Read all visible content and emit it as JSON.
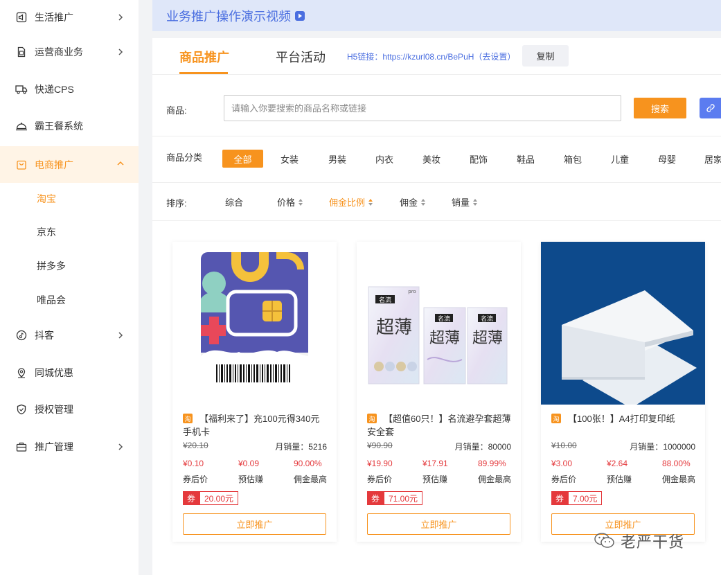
{
  "sidebar": {
    "items": [
      {
        "label": "生活推广",
        "icon": "megaphone-icon"
      },
      {
        "label": "运营商业务",
        "icon": "sim-card-icon"
      },
      {
        "label": "快递CPS",
        "icon": "truck-icon"
      },
      {
        "label": "霸王餐系统",
        "icon": "dish-cover-icon"
      },
      {
        "label": "电商推广",
        "icon": "shopping-bag-icon"
      },
      {
        "label": "抖客",
        "icon": "tiktok-icon"
      },
      {
        "label": "同城优惠",
        "icon": "location-pin-icon"
      },
      {
        "label": "授权管理",
        "icon": "shield-check-icon"
      },
      {
        "label": "推广管理",
        "icon": "briefcase-icon"
      }
    ],
    "sub_items": [
      "淘宝",
      "京东",
      "拼多多",
      "唯品会"
    ]
  },
  "banner": {
    "title": "业务推广操作演示视频"
  },
  "tabs": [
    "商品推广",
    "平台活动"
  ],
  "h5_link": "H5链接：https://kzurl08.cn/BePuH（去设置）",
  "copy_label": "复制",
  "search": {
    "label": "商品:",
    "placeholder": "请输入你要搜索的商品名称或链接",
    "button": "搜索"
  },
  "category": {
    "label": "商品分类",
    "items": [
      "全部",
      "女装",
      "男装",
      "内衣",
      "美妆",
      "配饰",
      "鞋品",
      "箱包",
      "儿童",
      "母婴",
      "居家"
    ]
  },
  "sort": {
    "label": "排序:",
    "items": [
      "综合",
      "价格",
      "佣金比例",
      "佣金",
      "销量"
    ]
  },
  "products": [
    {
      "platform_badge": "淘",
      "title": "【福利来了】充100元得340元手机卡",
      "original_price": "¥20.10",
      "monthly_sales": "月销量：5216",
      "coupon_price": "¥0.10",
      "estimated_earn": "¥0.09",
      "max_commission": "90.00%",
      "coupon_price_caption": "券后价",
      "estimated_earn_caption": "预估赚",
      "max_commission_caption": "佣金最高",
      "coupon_tag": "券",
      "coupon_amount": "20.00元",
      "promo_button": "立即推广"
    },
    {
      "platform_badge": "淘",
      "title": "【超值60只！】名流避孕套超薄安全套",
      "original_price": "¥90.90",
      "monthly_sales": "月销量：80000",
      "coupon_price": "¥19.90",
      "estimated_earn": "¥17.91",
      "max_commission": "89.99%",
      "coupon_price_caption": "券后价",
      "estimated_earn_caption": "预估赚",
      "max_commission_caption": "佣金最高",
      "coupon_tag": "券",
      "coupon_amount": "71.00元",
      "promo_button": "立即推广",
      "image_text": {
        "brand": "名流",
        "name": "超薄",
        "small": "pro"
      }
    },
    {
      "platform_badge": "淘",
      "title": "【100张！】A4打印复印纸",
      "original_price": "¥10.00",
      "monthly_sales": "月销量：1000000",
      "coupon_price": "¥3.00",
      "estimated_earn": "¥2.64",
      "max_commission": "88.00%",
      "coupon_price_caption": "券后价",
      "estimated_earn_caption": "预估赚",
      "max_commission_caption": "佣金最高",
      "coupon_tag": "券",
      "coupon_amount": "7.00元",
      "promo_button": "立即推广"
    }
  ],
  "watermark": {
    "text": "老严干货",
    "icon": "wechat-icon"
  },
  "colors": {
    "accent": "#f7931e",
    "link": "#4a6ee0",
    "price_red": "#e4393c",
    "banner_bg": "#dfe7f9"
  }
}
